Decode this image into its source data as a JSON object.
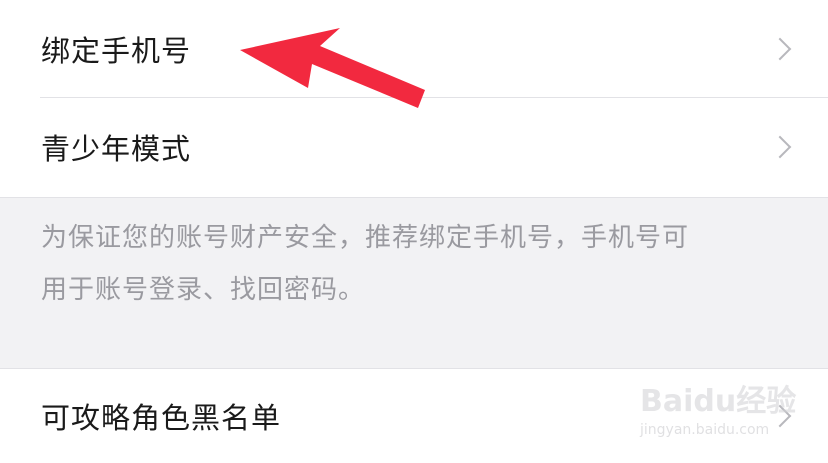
{
  "settings": {
    "rows": [
      {
        "label": "绑定手机号"
      },
      {
        "label": "青少年模式"
      }
    ],
    "note_lines": [
      "为保证您的账号财产安全，推荐绑定手机号，手机号可",
      "用于账号登录、找回密码。"
    ],
    "bottom_rows": [
      {
        "label": "可攻略角色黑名单"
      }
    ]
  },
  "annotation": {
    "arrow_color": "#f2293f",
    "arrow_target": "绑定手机号"
  },
  "watermark": {
    "main": "Baidu经验",
    "sub": "jingyan.baidu.com"
  }
}
